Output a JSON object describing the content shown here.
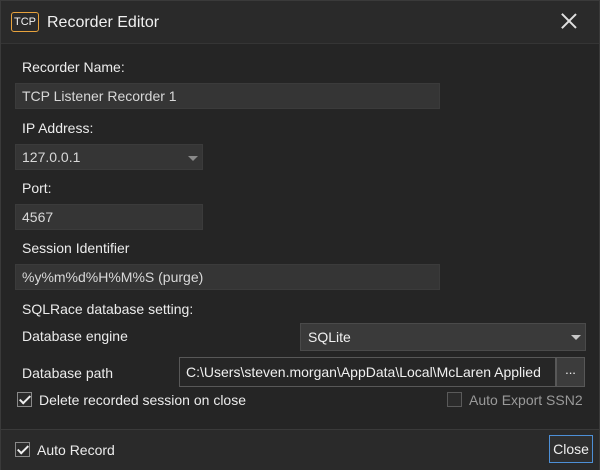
{
  "window": {
    "title": "Recorder Editor",
    "icon_text": "TCP"
  },
  "form": {
    "recorder_name_label": "Recorder Name:",
    "recorder_name_value": "TCP Listener Recorder 1",
    "ip_label": "IP Address:",
    "ip_value": "127.0.0.1",
    "port_label": "Port:",
    "port_value": "4567",
    "session_label": "Session Identifier",
    "session_value": "%y%m%d%H%M%S (purge)",
    "sqlrace_label": "SQLRace database setting:",
    "engine_label": "Database engine",
    "engine_value": "SQLite",
    "path_label": "Database path",
    "path_value": "C:\\Users\\steven.morgan\\AppData\\Local\\McLaren Applied",
    "browse_label": "...",
    "delete_label": "Delete recorded session on close",
    "delete_checked": true,
    "auto_export_label": "Auto Export SSN2",
    "auto_export_checked": false
  },
  "footer": {
    "auto_record_label": "Auto Record",
    "auto_record_checked": true,
    "close_label": "Close"
  },
  "colors": {
    "accent": "#4d8fd6",
    "icon_border": "#e8a33d",
    "background": "#252525"
  }
}
